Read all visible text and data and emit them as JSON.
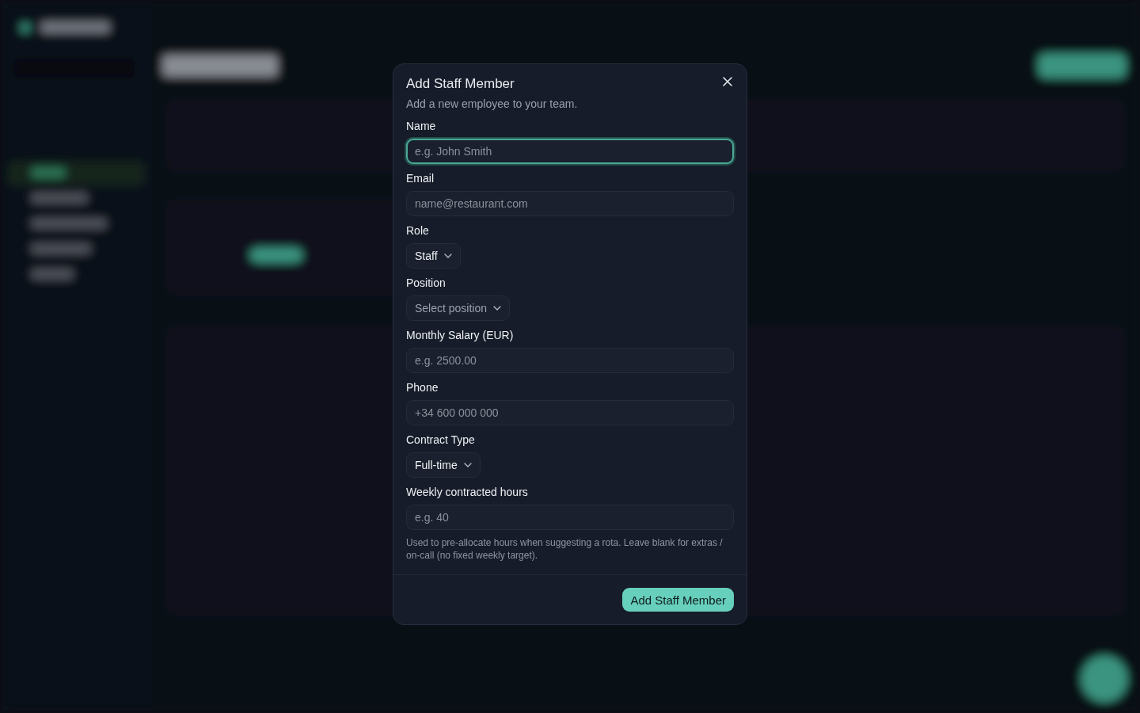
{
  "dialog": {
    "title": "Add Staff Member",
    "description": "Add a new employee to your team.",
    "fields": [
      {
        "kind": "text",
        "label": "Name",
        "placeholder": "e.g. John Smith",
        "focused": true
      },
      {
        "kind": "text",
        "label": "Email",
        "placeholder": "name@restaurant.com",
        "focused": false
      },
      {
        "kind": "select",
        "label": "Role",
        "value": "Staff",
        "focused": false
      },
      {
        "kind": "select",
        "label": "Position",
        "placeholder": "Select position",
        "focused": false
      },
      {
        "kind": "text",
        "label": "Monthly Salary (EUR)",
        "placeholder": "e.g. 2500.00",
        "focused": false
      },
      {
        "kind": "text",
        "label": "Phone",
        "placeholder": "+34 600 000 000",
        "focused": false
      },
      {
        "kind": "select",
        "label": "Contract Type",
        "value": "Full-time",
        "focused": false
      },
      {
        "kind": "text",
        "label": "Weekly contracted hours",
        "placeholder": "e.g. 40",
        "focused": false,
        "help": "Used to pre-allocate hours when suggesting a rota. Leave blank for extras / on-call (no fixed weekly target)."
      }
    ],
    "submit": "Add Staff Member"
  }
}
